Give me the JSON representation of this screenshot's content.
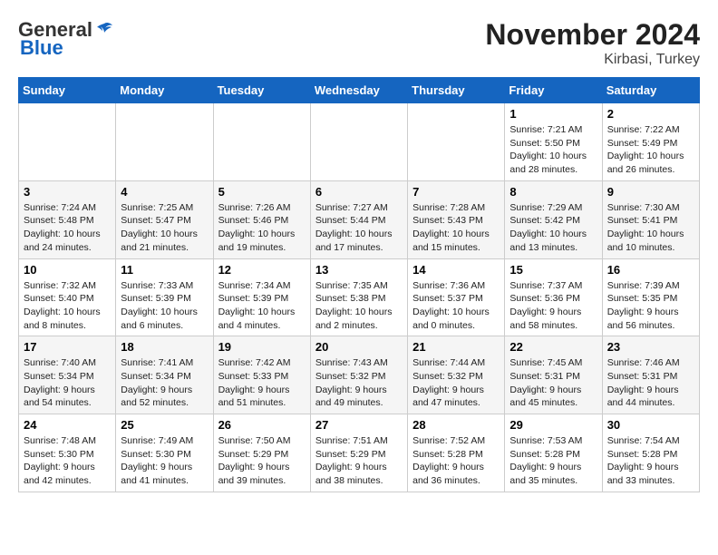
{
  "logo": {
    "general": "General",
    "blue": "Blue"
  },
  "header": {
    "month": "November 2024",
    "location": "Kirbasi, Turkey"
  },
  "weekdays": [
    "Sunday",
    "Monday",
    "Tuesday",
    "Wednesday",
    "Thursday",
    "Friday",
    "Saturday"
  ],
  "weeks": [
    [
      {
        "day": "",
        "info": ""
      },
      {
        "day": "",
        "info": ""
      },
      {
        "day": "",
        "info": ""
      },
      {
        "day": "",
        "info": ""
      },
      {
        "day": "",
        "info": ""
      },
      {
        "day": "1",
        "info": "Sunrise: 7:21 AM\nSunset: 5:50 PM\nDaylight: 10 hours\nand 28 minutes."
      },
      {
        "day": "2",
        "info": "Sunrise: 7:22 AM\nSunset: 5:49 PM\nDaylight: 10 hours\nand 26 minutes."
      }
    ],
    [
      {
        "day": "3",
        "info": "Sunrise: 7:24 AM\nSunset: 5:48 PM\nDaylight: 10 hours\nand 24 minutes."
      },
      {
        "day": "4",
        "info": "Sunrise: 7:25 AM\nSunset: 5:47 PM\nDaylight: 10 hours\nand 21 minutes."
      },
      {
        "day": "5",
        "info": "Sunrise: 7:26 AM\nSunset: 5:46 PM\nDaylight: 10 hours\nand 19 minutes."
      },
      {
        "day": "6",
        "info": "Sunrise: 7:27 AM\nSunset: 5:44 PM\nDaylight: 10 hours\nand 17 minutes."
      },
      {
        "day": "7",
        "info": "Sunrise: 7:28 AM\nSunset: 5:43 PM\nDaylight: 10 hours\nand 15 minutes."
      },
      {
        "day": "8",
        "info": "Sunrise: 7:29 AM\nSunset: 5:42 PM\nDaylight: 10 hours\nand 13 minutes."
      },
      {
        "day": "9",
        "info": "Sunrise: 7:30 AM\nSunset: 5:41 PM\nDaylight: 10 hours\nand 10 minutes."
      }
    ],
    [
      {
        "day": "10",
        "info": "Sunrise: 7:32 AM\nSunset: 5:40 PM\nDaylight: 10 hours\nand 8 minutes."
      },
      {
        "day": "11",
        "info": "Sunrise: 7:33 AM\nSunset: 5:39 PM\nDaylight: 10 hours\nand 6 minutes."
      },
      {
        "day": "12",
        "info": "Sunrise: 7:34 AM\nSunset: 5:39 PM\nDaylight: 10 hours\nand 4 minutes."
      },
      {
        "day": "13",
        "info": "Sunrise: 7:35 AM\nSunset: 5:38 PM\nDaylight: 10 hours\nand 2 minutes."
      },
      {
        "day": "14",
        "info": "Sunrise: 7:36 AM\nSunset: 5:37 PM\nDaylight: 10 hours\nand 0 minutes."
      },
      {
        "day": "15",
        "info": "Sunrise: 7:37 AM\nSunset: 5:36 PM\nDaylight: 9 hours\nand 58 minutes."
      },
      {
        "day": "16",
        "info": "Sunrise: 7:39 AM\nSunset: 5:35 PM\nDaylight: 9 hours\nand 56 minutes."
      }
    ],
    [
      {
        "day": "17",
        "info": "Sunrise: 7:40 AM\nSunset: 5:34 PM\nDaylight: 9 hours\nand 54 minutes."
      },
      {
        "day": "18",
        "info": "Sunrise: 7:41 AM\nSunset: 5:34 PM\nDaylight: 9 hours\nand 52 minutes."
      },
      {
        "day": "19",
        "info": "Sunrise: 7:42 AM\nSunset: 5:33 PM\nDaylight: 9 hours\nand 51 minutes."
      },
      {
        "day": "20",
        "info": "Sunrise: 7:43 AM\nSunset: 5:32 PM\nDaylight: 9 hours\nand 49 minutes."
      },
      {
        "day": "21",
        "info": "Sunrise: 7:44 AM\nSunset: 5:32 PM\nDaylight: 9 hours\nand 47 minutes."
      },
      {
        "day": "22",
        "info": "Sunrise: 7:45 AM\nSunset: 5:31 PM\nDaylight: 9 hours\nand 45 minutes."
      },
      {
        "day": "23",
        "info": "Sunrise: 7:46 AM\nSunset: 5:31 PM\nDaylight: 9 hours\nand 44 minutes."
      }
    ],
    [
      {
        "day": "24",
        "info": "Sunrise: 7:48 AM\nSunset: 5:30 PM\nDaylight: 9 hours\nand 42 minutes."
      },
      {
        "day": "25",
        "info": "Sunrise: 7:49 AM\nSunset: 5:30 PM\nDaylight: 9 hours\nand 41 minutes."
      },
      {
        "day": "26",
        "info": "Sunrise: 7:50 AM\nSunset: 5:29 PM\nDaylight: 9 hours\nand 39 minutes."
      },
      {
        "day": "27",
        "info": "Sunrise: 7:51 AM\nSunset: 5:29 PM\nDaylight: 9 hours\nand 38 minutes."
      },
      {
        "day": "28",
        "info": "Sunrise: 7:52 AM\nSunset: 5:28 PM\nDaylight: 9 hours\nand 36 minutes."
      },
      {
        "day": "29",
        "info": "Sunrise: 7:53 AM\nSunset: 5:28 PM\nDaylight: 9 hours\nand 35 minutes."
      },
      {
        "day": "30",
        "info": "Sunrise: 7:54 AM\nSunset: 5:28 PM\nDaylight: 9 hours\nand 33 minutes."
      }
    ]
  ]
}
